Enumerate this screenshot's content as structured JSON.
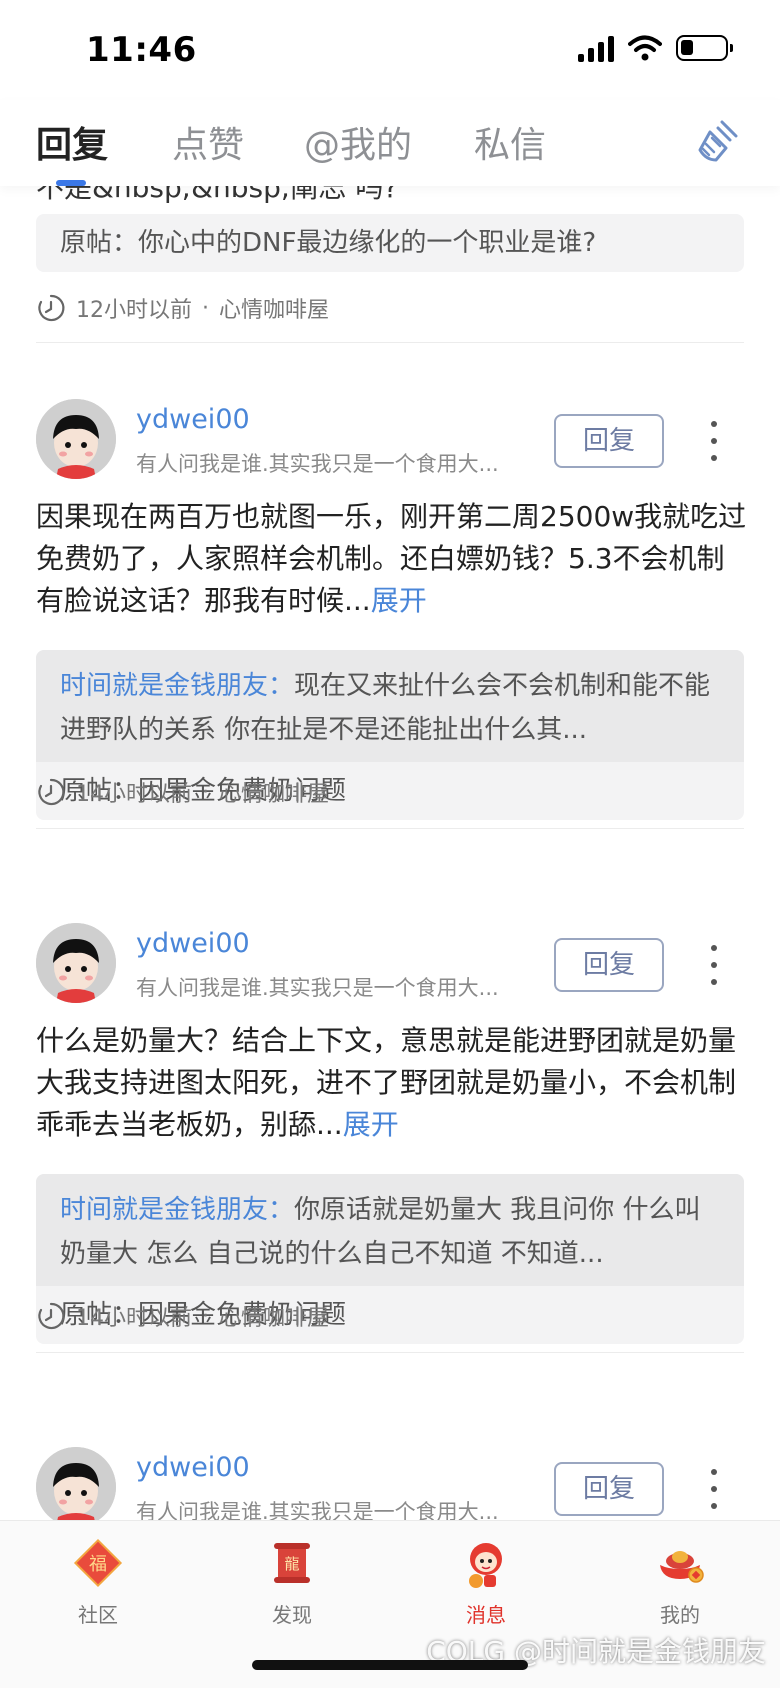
{
  "status_bar": {
    "time": "11:46"
  },
  "tabs": [
    {
      "label": "回复",
      "active": true
    },
    {
      "label": "点赞",
      "active": false
    },
    {
      "label": "@我的",
      "active": false
    },
    {
      "label": "私信",
      "active": false
    }
  ],
  "colors": {
    "accent": "#4a86d8",
    "active_nav": "#e0332b"
  },
  "partial_item": {
    "cut_text": "不是&nbsp;&nbsp;阐忘 吗?",
    "original_post": "原帖：你心中的DNF最边缘化的一个职业是谁?",
    "time": "12小时以前",
    "board": "心情咖啡屋"
  },
  "items": [
    {
      "username": "ydwei00",
      "signature": "有人问我是谁.其实我只是一个食用大...",
      "reply_button": "回复",
      "body": "因果现在两百万也就图一乐，刚开第二周2500w我就吃过免费奶了，人家照样会机制。还白嫖奶钱？5.3不会机制有脸说这话？那我有时候...",
      "expand_label": "展开",
      "quoted_user": "时间就是金钱朋友：",
      "quoted_text": "现在又来扯什么会不会机制和能不能进野队的关系 你在扯是不是还能扯出什么其...",
      "original_post": "原帖：因果金免费奶问题",
      "time": "14小时以前",
      "board": "心情咖啡屋"
    },
    {
      "username": "ydwei00",
      "signature": "有人问我是谁.其实我只是一个食用大...",
      "reply_button": "回复",
      "body": "什么是奶量大？结合上下文，意思就是能进野团就是奶量大我支持进图太阳死，进不了野团就是奶量小，不会机制乖乖去当老板奶，别舔...",
      "expand_label": "展开",
      "quoted_user": "时间就是金钱朋友：",
      "quoted_text": "你原话就是奶量大 我且问你 什么叫奶量大 怎么 自己说的什么自己不知道 不知道...",
      "original_post": "原帖：因果金免费奶问题",
      "time": "14小时以前",
      "board": "心情咖啡屋"
    },
    {
      "username": "ydwei00",
      "signature": "有人问我是谁.其实我只是一个食用大...",
      "reply_button": "回复"
    }
  ],
  "meta_separator": "·",
  "bottom_nav": [
    {
      "label": "社区",
      "icon": "fu-diamond-icon",
      "active": false
    },
    {
      "label": "发现",
      "icon": "dragon-scroll-icon",
      "active": false
    },
    {
      "label": "消息",
      "icon": "mascot-message-icon",
      "active": true
    },
    {
      "label": "我的",
      "icon": "gold-ingot-icon",
      "active": false
    }
  ],
  "watermark": "COLG @时间就是金钱朋友"
}
